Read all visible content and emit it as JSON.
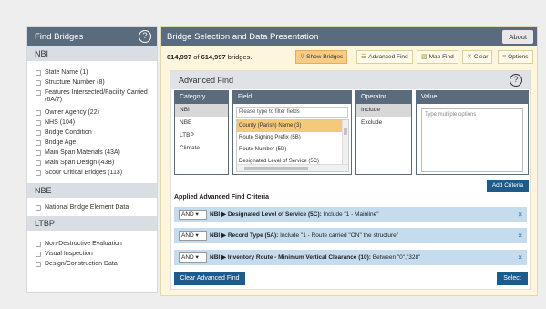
{
  "left_panel": {
    "title": "Find Bridges",
    "help_icon": "question-circle-icon",
    "sections": [
      {
        "title": "NBI",
        "items": [
          "State Name (1)",
          "Structure Number (8)",
          "Features Intersected/Facility Carried (6A/7)",
          "Owner Agency (22)",
          "NHS (104)",
          "Bridge Condition",
          "Bridge Age",
          "Main Span Materials (43A)",
          "Main Span Design (43B)",
          "Scour Critical Bridges (113)"
        ]
      },
      {
        "title": "NBE",
        "items": [
          "National Bridge Element Data"
        ]
      },
      {
        "title": "LTBP",
        "items": [
          "Non-Destructive Evaluation",
          "Visual Inspection",
          "Design/Construction Data"
        ]
      }
    ]
  },
  "main_panel": {
    "title": "Bridge Selection and Data Presentation",
    "about_label": "About",
    "count_selected": "614,997",
    "count_of": "of",
    "count_total": "614,997",
    "count_suffix": "bridges.",
    "toolbar": {
      "show_bridges": "Show Bridges",
      "advanced_find": "Advanced Find",
      "map_find": "Map Find",
      "clear": "Clear",
      "options": "Options"
    }
  },
  "advanced_find": {
    "title": "Advanced Find",
    "category": {
      "header": "Category",
      "items": [
        "NBI",
        "NBE",
        "LTBP",
        "Climate"
      ],
      "selected_index": 0
    },
    "field": {
      "header": "Field",
      "filter_placeholder": "Please type to filter fields",
      "items": [
        "County (Parish) Name (3)",
        "Route Signing Prefix (5B)",
        "Route Number (5D)",
        "Designated Level of Service (5C)"
      ],
      "selected_index": 0
    },
    "operator": {
      "header": "Operator",
      "items": [
        "Include",
        "Exclude"
      ],
      "selected_index": 0
    },
    "value": {
      "header": "Value",
      "placeholder": "Type multiple options"
    },
    "add_criteria_label": "Add Criteria",
    "applied_title": "Applied Advanced Find Criteria",
    "criteria": [
      {
        "conj": "AND",
        "group": "NBI",
        "field": "Designated Level of Service (5C):",
        "rest": "Include \"1 - Mainline\""
      },
      {
        "conj": "AND",
        "group": "NBI",
        "field": "Record Type (5A):",
        "rest": "Include \"1 - Route carried \"ON\" the structure\""
      },
      {
        "conj": "AND",
        "group": "NBI",
        "field": "Inventory Route - Minimum Vertical Clearance (10):",
        "rest": "Between \"0\",\"328\""
      }
    ],
    "clear_label": "Clear Advanced Find",
    "select_label": "Select"
  },
  "colors": {
    "header_bg": "#5a6b7d",
    "panel_bg": "#fdf6dc",
    "primary_btn": "#1e5a8a",
    "criteria_bg": "#c5dcef",
    "highlight": "#f5c97a"
  }
}
